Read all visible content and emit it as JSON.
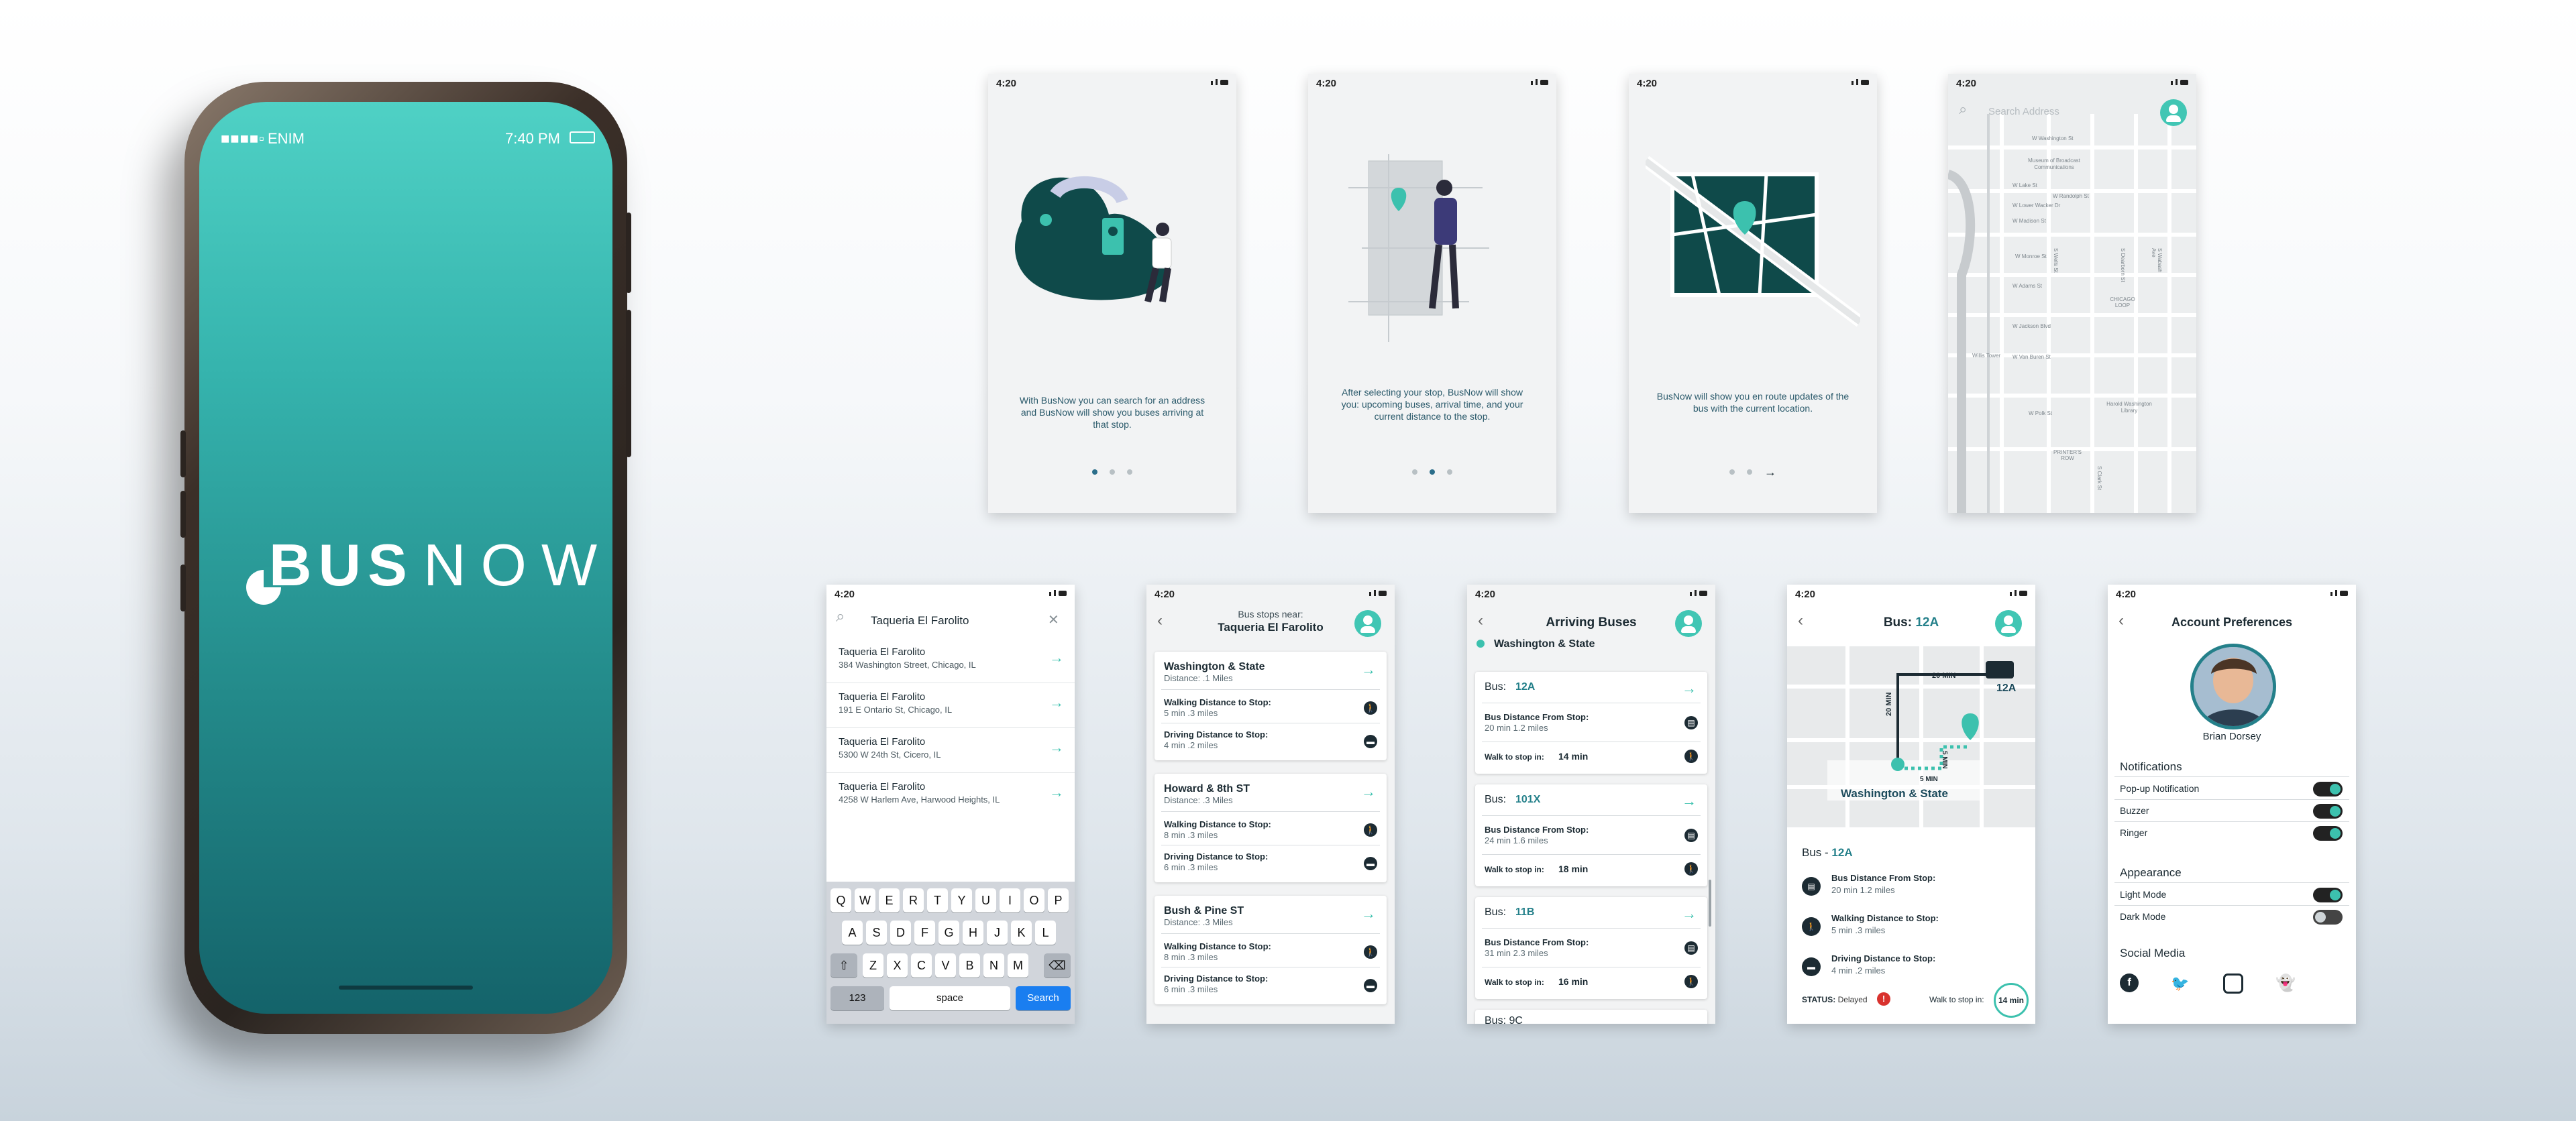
{
  "phone": {
    "carrier": "ENIM",
    "time": "7:40 PM",
    "logo_bold": "BUS",
    "logo_light": "NOW"
  },
  "status_time": "4:20",
  "onboarding": [
    {
      "caption": "With BusNow you can search for an address and BusNow will show you buses arriving at that stop."
    },
    {
      "caption": "After selecting your stop, BusNow will show you: upcoming buses, arrival time, and your current distance to the stop."
    },
    {
      "caption": "BusNow will show you en route updates of the bus with the current location."
    }
  ],
  "map_screen": {
    "search_placeholder": "Search Address",
    "streets": [
      "Museum of Broadcast Communications",
      "W Washington St",
      "W Lake St",
      "W Randolph St",
      "W Lower Wacker Dr",
      "W Madison St",
      "W Monroe St",
      "W Adams St",
      "W Jackson Blvd",
      "W Van Buren St",
      "CHICAGO LOOP",
      "S Wells St",
      "S Dearborn St",
      "S Wabash Ave",
      "Willis Tower",
      "Harold Washington Library",
      "PRINTER'S ROW",
      "W Polk St",
      "S Clark St"
    ]
  },
  "search_screen": {
    "query": "Taqueria El Farolito",
    "results": [
      {
        "name": "Taqueria El Farolito",
        "address": "384 Washington Street, Chicago, IL"
      },
      {
        "name": "Taqueria El Farolito",
        "address": "191 E Ontario St, Chicago, IL"
      },
      {
        "name": "Taqueria El Farolito",
        "address": "5300 W 24th St, Cicero, IL"
      },
      {
        "name": "Taqueria El Farolito",
        "address": "4258 W Harlem Ave, Harwood Heights, IL"
      }
    ],
    "keyboard_rows": [
      [
        "Q",
        "W",
        "E",
        "R",
        "T",
        "Y",
        "U",
        "I",
        "O",
        "P"
      ],
      [
        "A",
        "S",
        "D",
        "F",
        "G",
        "H",
        "J",
        "K",
        "L"
      ],
      [
        "Z",
        "X",
        "C",
        "V",
        "B",
        "N",
        "M"
      ]
    ],
    "key_123": "123",
    "key_space": "space",
    "key_search": "Search"
  },
  "stops_screen": {
    "header_small": "Bus stops near:",
    "header_big": "Taqueria El Farolito",
    "stops": [
      {
        "name": "Washington & State",
        "distance": "Distance: .1 Miles",
        "walk_label": "Walking Distance to Stop:",
        "walk": "5 min   .3 miles",
        "drive_label": "Driving Distance to Stop:",
        "drive": "4 min   .2 miles"
      },
      {
        "name": "Howard & 8th ST",
        "distance": "Distance: .3 Miles",
        "walk_label": "Walking Distance to Stop:",
        "walk": "8 min   .3 miles",
        "drive_label": "Driving Distance to Stop:",
        "drive": "6 min   .3 miles"
      },
      {
        "name": "Bush & Pine ST",
        "distance": "Distance: .3 Miles",
        "walk_label": "Walking Distance to Stop:",
        "walk": "8 min   .3 miles",
        "drive_label": "Driving Distance to Stop:",
        "drive": "6 min   .3 miles"
      }
    ]
  },
  "arriving_screen": {
    "title": "Arriving Buses",
    "stop": "Washington & State",
    "bus_prefix": "Bus:",
    "dist_label": "Bus Distance From Stop:",
    "walk_label": "Walk to stop in:",
    "buses": [
      {
        "bus": "12A",
        "dist": "20 min  1.2 miles",
        "walk": "14 min"
      },
      {
        "bus": "101X",
        "dist": "24 min  1.6 miles",
        "walk": "18 min"
      },
      {
        "bus": "11B",
        "dist": "31 min  2.3 miles",
        "walk": "16 min"
      }
    ],
    "partial_bus": "Bus:  9C"
  },
  "bus_detail": {
    "title_prefix": "Bus:",
    "title_bus": "12A",
    "map_bus": "12A",
    "map_stop": "Washington & State",
    "map_20min_h": "20 MIN",
    "map_20min_v": "20 MIN",
    "map_5min_h": "5 MIN",
    "map_5min_v": "5 MIN",
    "section_prefix": "Bus - ",
    "section_bus": "12A",
    "rows": [
      {
        "label": "Bus Distance From Stop:",
        "value": "20 min  1.2 miles"
      },
      {
        "label": "Walking Distance to Stop:",
        "value": "5 min   .3 miles"
      },
      {
        "label": "Driving Distance to Stop:",
        "value": "4 min   .2 miles"
      }
    ],
    "status_label": "STATUS:",
    "status_value": "Delayed",
    "walk_label": "Walk to stop in:",
    "walk_value": "14 min"
  },
  "account": {
    "title": "Account Preferences",
    "name": "Brian Dorsey",
    "notifications_title": "Notifications",
    "notifications": [
      {
        "label": "Pop-up Notification",
        "on": true
      },
      {
        "label": "Buzzer",
        "on": true
      },
      {
        "label": "Ringer",
        "on": true
      }
    ],
    "appearance_title": "Appearance",
    "appearance": [
      {
        "label": "Light Mode",
        "on": true
      },
      {
        "label": "Dark Mode",
        "on": false
      }
    ],
    "social_title": "Social Media",
    "social": [
      "facebook-icon",
      "twitter-icon",
      "instagram-icon",
      "snapchat-icon"
    ]
  },
  "colors": {
    "teal": "#3cc1ae",
    "dark": "#1c2b33",
    "brand_gradient_top": "#4fd1c5",
    "brand_gradient_bottom": "#14636a",
    "status_delayed": "#d9322e"
  }
}
